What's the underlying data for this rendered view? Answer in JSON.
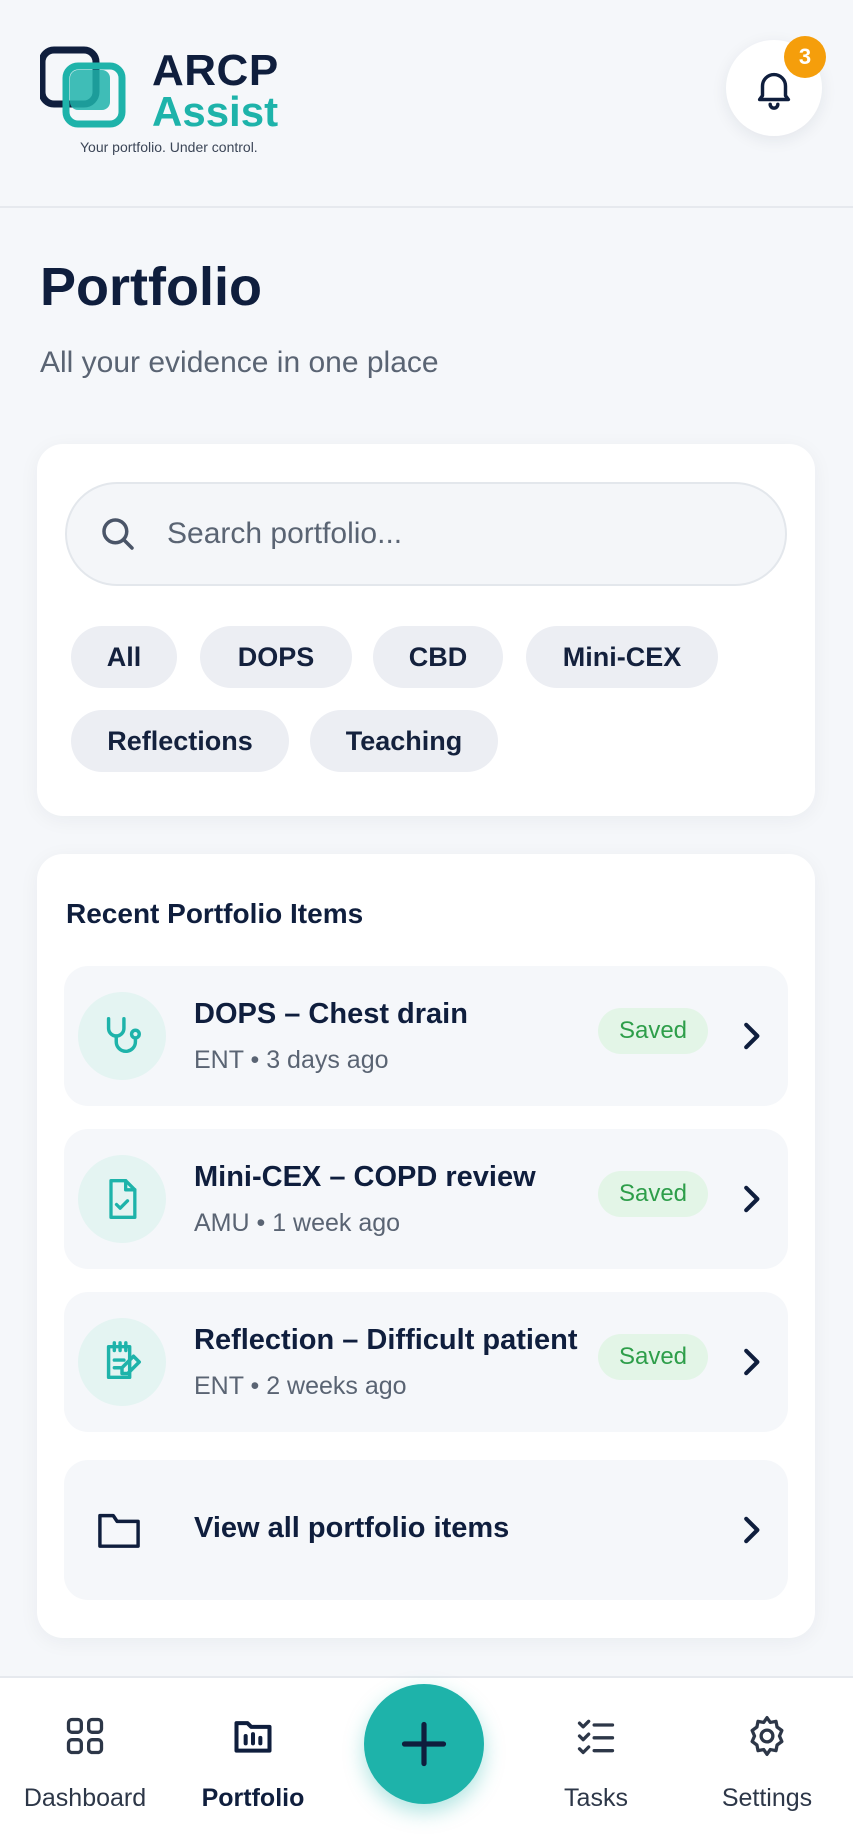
{
  "header": {
    "logo_line1": "ARCP",
    "logo_line2": "Assist",
    "tagline": "Your portfolio. Under control.",
    "notification_count": "3"
  },
  "page": {
    "title": "Portfolio",
    "subtitle": "All your evidence in one place"
  },
  "search": {
    "placeholder": "Search portfolio..."
  },
  "filters": [
    {
      "label": "All"
    },
    {
      "label": "DOPS"
    },
    {
      "label": "CBD"
    },
    {
      "label": "Mini-CEX"
    },
    {
      "label": "Reflections"
    },
    {
      "label": "Teaching"
    }
  ],
  "recent": {
    "title": "Recent Portfolio Items",
    "items": [
      {
        "title": "DOPS – Chest drain",
        "meta": "ENT • 3 days ago",
        "status": "Saved",
        "icon": "stethoscope-icon"
      },
      {
        "title": "Mini-CEX – COPD review",
        "meta": "AMU • 1 week ago",
        "status": "Saved",
        "icon": "document-check-icon"
      },
      {
        "title": "Reflection – Difficult patient",
        "meta": "ENT • 2 weeks ago",
        "status": "Saved",
        "icon": "notepad-pen-icon"
      }
    ],
    "view_all": "View all portfolio items"
  },
  "nav": {
    "items": [
      {
        "label": "Dashboard",
        "icon": "grid-icon"
      },
      {
        "label": "Portfolio",
        "icon": "portfolio-icon",
        "active": true
      },
      {
        "label": "Tasks",
        "icon": "checklist-icon"
      },
      {
        "label": "Settings",
        "icon": "gear-icon"
      }
    ],
    "fab_icon": "plus-icon"
  },
  "colors": {
    "accent": "#1eb3aa",
    "navy": "#0f1e3d",
    "badge": "#f59e0b",
    "status_green": "#2e9e4a"
  }
}
